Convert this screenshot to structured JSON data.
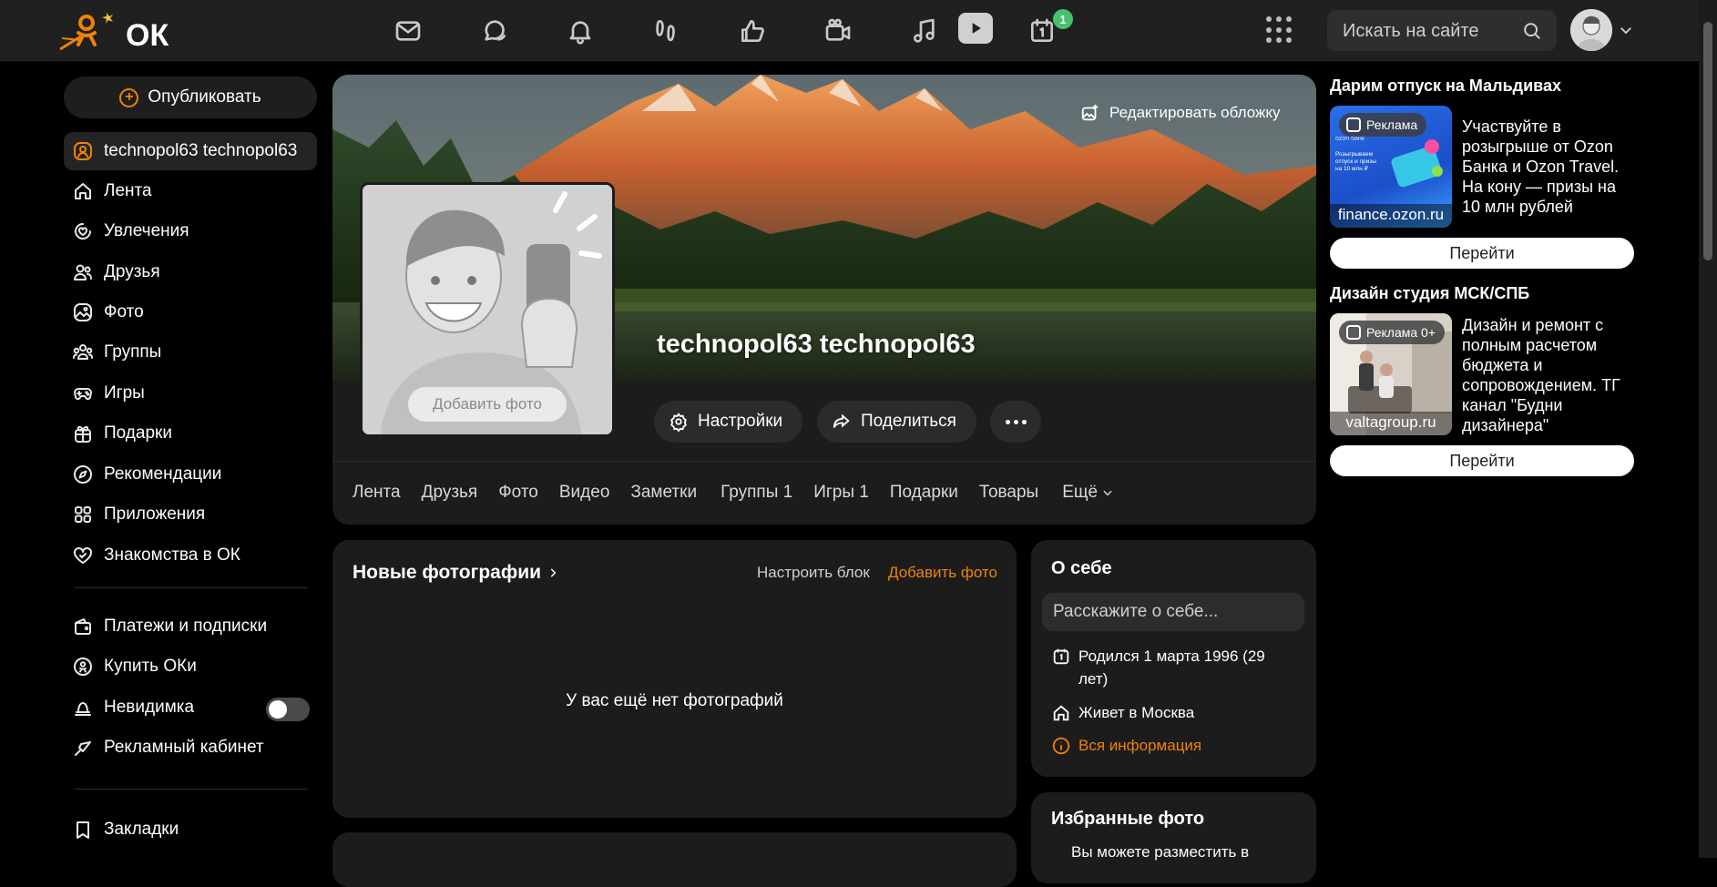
{
  "topbar": {
    "logo_text": "ОК",
    "notification_count": "1",
    "search_placeholder": "Искать на сайте",
    "nav_icons": [
      "messages-icon",
      "discussions-icon",
      "notifications-icon",
      "guests-icon",
      "reactions-icon",
      "video-calls-icon",
      "music-icon",
      "video-icon",
      "events-icon"
    ]
  },
  "sidebar": {
    "publish_label": "Опубликовать",
    "items": [
      {
        "label": "technopol63 technopol63",
        "icon": "user-icon"
      },
      {
        "label": "Лента",
        "icon": "home-icon"
      },
      {
        "label": "Увлечения",
        "icon": "hobbies-icon"
      },
      {
        "label": "Друзья",
        "icon": "friends-icon"
      },
      {
        "label": "Фото",
        "icon": "photo-icon"
      },
      {
        "label": "Группы",
        "icon": "groups-icon"
      },
      {
        "label": "Игры",
        "icon": "gamepad-icon"
      },
      {
        "label": "Подарки",
        "icon": "gift-icon"
      },
      {
        "label": "Рекомендации",
        "icon": "compass-icon"
      },
      {
        "label": "Приложения",
        "icon": "apps-icon"
      },
      {
        "label": "Знакомства в ОК",
        "icon": "dating-icon"
      }
    ],
    "items2": [
      {
        "label": "Платежи и подписки",
        "icon": "wallet-icon"
      },
      {
        "label": "Купить ОКи",
        "icon": "ok-coin-icon"
      },
      {
        "label": "Невидимка",
        "icon": "invisible-icon"
      },
      {
        "label": "Рекламный кабинет",
        "icon": "ads-cabinet-icon"
      }
    ],
    "bookmarks_label": "Закладки"
  },
  "profile": {
    "name": "technopol63 technopol63",
    "edit_cover_label": "Редактировать обложку",
    "add_photo_label": "Добавить фото",
    "settings_label": "Настройки",
    "share_label": "Поделиться",
    "tabs": [
      "Лента",
      "Друзья",
      "Фото",
      "Видео",
      "Заметки",
      "Группы 1",
      "Игры 1",
      "Подарки",
      "Товары",
      "Ещё"
    ]
  },
  "photos_block": {
    "title": "Новые фотографии",
    "configure_label": "Настроить блок",
    "add_label": "Добавить фото",
    "empty_text": "У вас ещё нет фотографий"
  },
  "about": {
    "title": "О себе",
    "placeholder": "Расскажите о себе...",
    "born": "Родился 1 марта 1996 (29 лет)",
    "lives": "Живет в Москва",
    "all_info": "Вся информация"
  },
  "favorites": {
    "title": "Избранные фото",
    "text": "Вы можете разместить в"
  },
  "ads": [
    {
      "title": "Дарим отпуск на Мальдивах",
      "tag": "Реклама",
      "domain": "finance.ozon.ru",
      "text": "Участвуйте в розыгрыше от Ozon Банка и Ozon Travel. На кону — призы на 10 млн рублей",
      "button": "Перейти",
      "image_caption": "Розыгрываем отпуск и призы на 10 млн ₽"
    },
    {
      "title": "Дизайн студия МСК/СПБ",
      "tag": "Реклама 0+",
      "domain": "valtagroup.ru",
      "text": "Дизайн и ремонт с полным расчетом бюджета и сопровождением. ТГ канал \"Будни дизайнера\"",
      "button": "Перейти"
    }
  ],
  "colors": {
    "accent": "#ee8208",
    "background": "#000000",
    "card": "#1c1c1c",
    "topbar": "#202020",
    "badge": "#46c26b"
  }
}
